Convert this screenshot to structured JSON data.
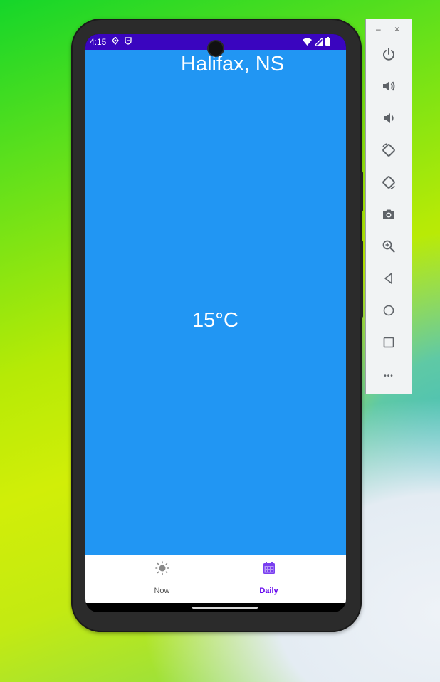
{
  "status_bar": {
    "time": "4:15",
    "icons": [
      "location-icon",
      "shield-icon",
      "wifi-icon",
      "signal-icon",
      "battery-icon"
    ]
  },
  "app": {
    "city": "Halifax, NS",
    "temperature": "15°C",
    "background_color": "#2196f3",
    "status_bar_color": "#3a05bf"
  },
  "bottom_nav": {
    "items": [
      {
        "label": "Now",
        "icon": "sun-icon",
        "selected": false
      },
      {
        "label": "Daily",
        "icon": "calendar-icon",
        "selected": true
      }
    ],
    "selected_color": "#6200ee"
  },
  "emulator_toolbar": {
    "window_controls": {
      "minimize": "–",
      "close": "×"
    },
    "buttons": [
      "power-icon",
      "volume-up-icon",
      "volume-down-icon",
      "rotate-left-icon",
      "rotate-right-icon",
      "camera-icon",
      "zoom-icon",
      "back-icon",
      "home-icon",
      "overview-icon",
      "more-icon"
    ],
    "more_label": "•••"
  }
}
